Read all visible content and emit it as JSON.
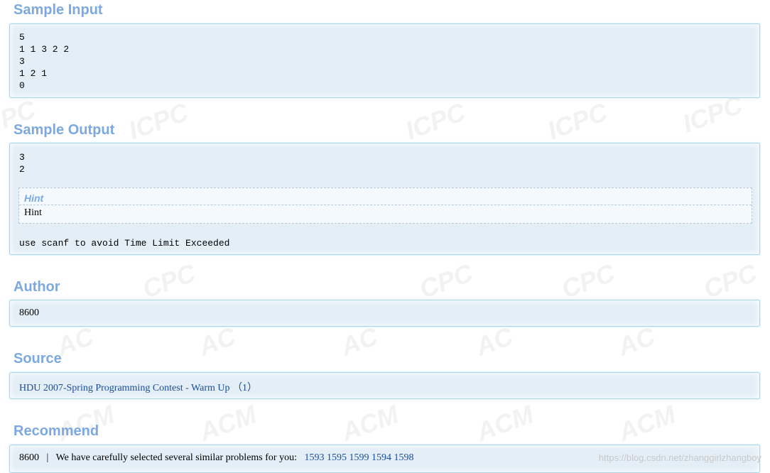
{
  "sections": {
    "sample_input": {
      "title": "Sample Input",
      "text": "5\n1 1 3 2 2\n3\n1 2 1\n0"
    },
    "sample_output": {
      "title": "Sample Output",
      "text": "3\n2",
      "hint_title": "Hint",
      "hint_body": "Hint",
      "note": "use scanf to avoid Time Limit Exceeded"
    },
    "author": {
      "title": "Author",
      "text": "8600"
    },
    "source": {
      "title": "Source",
      "link": "HDU 2007-Spring Programming Contest - Warm Up （1）"
    },
    "recommend": {
      "title": "Recommend",
      "author": "8600",
      "separator": "|",
      "text": "We have carefully selected several similar problems for you:",
      "problems": [
        "1593",
        "1595",
        "1599",
        "1594",
        "1598"
      ]
    }
  },
  "watermark": {
    "text": "ACM ICPC",
    "url": "https://blog.csdn.net/zhanggirlzhangboy"
  }
}
